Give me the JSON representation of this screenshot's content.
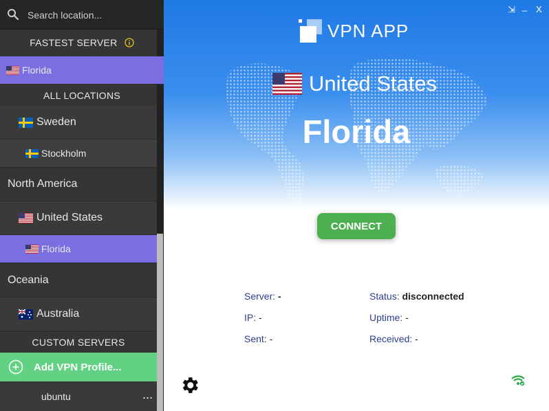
{
  "search": {
    "placeholder": "Search location..."
  },
  "sidebar": {
    "fastest_header": "FASTEST SERVER",
    "fastest_item": "Florida",
    "all_locations_header": "ALL LOCATIONS",
    "items": [
      {
        "label": "Sweden"
      },
      {
        "label": "Stockholm"
      },
      {
        "label": "North America"
      },
      {
        "label": "United States"
      },
      {
        "label": "Florida"
      },
      {
        "label": "Oceania"
      },
      {
        "label": "Australia"
      }
    ],
    "custom_header": "CUSTOM SERVERS",
    "add_profile": "Add VPN Profile...",
    "profile": "ubuntu",
    "more": "..."
  },
  "window": {
    "minimize_alt": "⇲",
    "minimize": "_",
    "close": "X"
  },
  "app": {
    "logo_text": "VPN APP",
    "country": "United States",
    "city": "Florida",
    "connect_label": "CONNECT"
  },
  "stats": {
    "server_label": "Server:",
    "server_value": "-",
    "status_label": "Status:",
    "status_value": "disconnected",
    "ip_label": "IP:",
    "ip_value": "-",
    "uptime_label": "Uptime:",
    "uptime_value": "-",
    "sent_label": "Sent:",
    "sent_value": "-",
    "received_label": "Received:",
    "received_value": "-"
  },
  "colors": {
    "accent": "#7b6ee0",
    "connect": "#4caf50",
    "add": "#62d184",
    "hero": "#2a84ea"
  },
  "icons": {
    "search": "search-icon",
    "info": "info-icon",
    "gear": "gear-icon",
    "wifi": "wifi-icon"
  }
}
